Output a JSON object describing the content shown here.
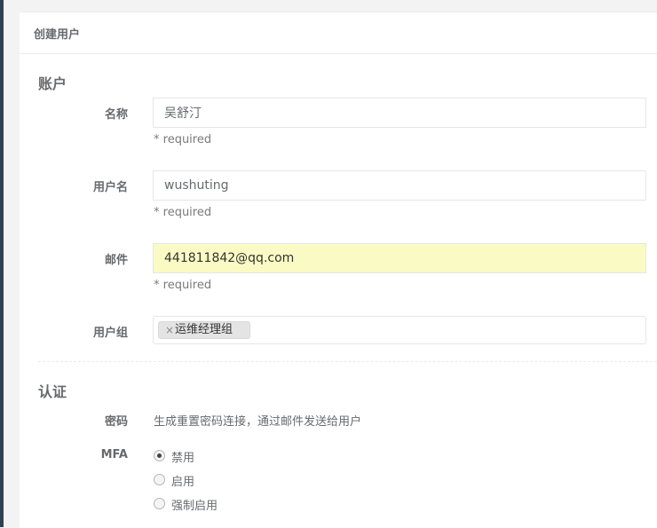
{
  "card": {
    "title": "创建用户"
  },
  "account_section": {
    "title": "账户",
    "name": {
      "label": "名称",
      "value": "吴舒汀",
      "help": "* required"
    },
    "username": {
      "label": "用户名",
      "value": "wushuting",
      "help": "* required"
    },
    "email": {
      "label": "邮件",
      "value": "441811842@qq.com",
      "help": "* required"
    },
    "group": {
      "label": "用户组",
      "tags": [
        {
          "remove": "×",
          "text": "运维经理组"
        }
      ]
    }
  },
  "auth_section": {
    "title": "认证",
    "password": {
      "label": "密码",
      "text": "生成重置密码连接，通过邮件发送给用户"
    },
    "mfa": {
      "label": "MFA",
      "options": [
        {
          "label": "禁用",
          "checked": true
        },
        {
          "label": "启用",
          "checked": false
        },
        {
          "label": "强制启用",
          "checked": false
        }
      ]
    }
  },
  "colors": {
    "autofill_bg": "#fafbc4",
    "sidebar": "#2f4050"
  }
}
